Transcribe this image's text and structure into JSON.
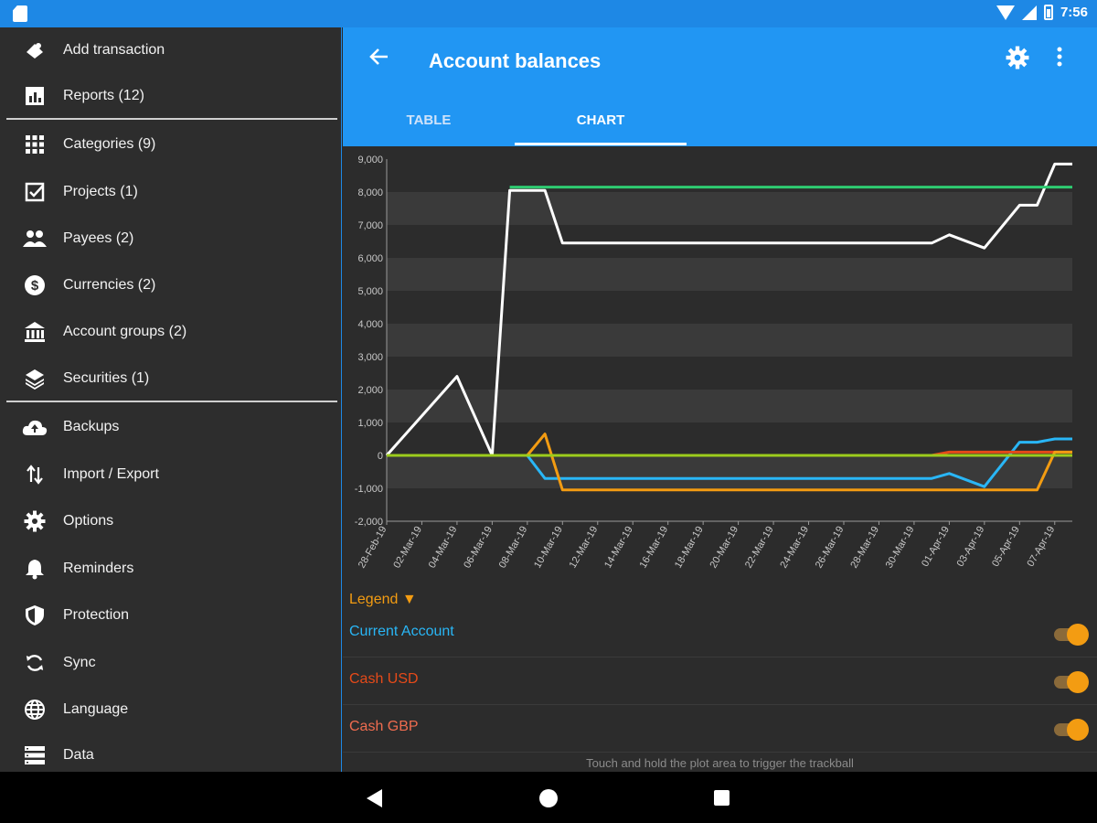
{
  "status": {
    "time": "7:56"
  },
  "drawer": {
    "items": [
      {
        "label": "Add transaction",
        "icon": "add-transaction-icon"
      },
      {
        "label": "Reports (12)",
        "icon": "reports-icon"
      },
      {
        "label": "Categories (9)",
        "icon": "grid-icon"
      },
      {
        "label": "Projects (1)",
        "icon": "checkbox-icon"
      },
      {
        "label": "Payees (2)",
        "icon": "people-icon"
      },
      {
        "label": "Currencies (2)",
        "icon": "dollar-icon"
      },
      {
        "label": "Account groups (2)",
        "icon": "bank-icon"
      },
      {
        "label": "Securities (1)",
        "icon": "layers-icon"
      },
      {
        "label": "Backups",
        "icon": "cloud-upload-icon"
      },
      {
        "label": "Import / Export",
        "icon": "import-export-icon"
      },
      {
        "label": "Options",
        "icon": "gear-icon"
      },
      {
        "label": "Reminders",
        "icon": "bell-icon"
      },
      {
        "label": "Protection",
        "icon": "shield-icon"
      },
      {
        "label": "Sync",
        "icon": "sync-icon"
      },
      {
        "label": "Language",
        "icon": "globe-icon"
      },
      {
        "label": "Data",
        "icon": "data-icon"
      }
    ]
  },
  "appbar": {
    "title": "Account balances",
    "tabs": [
      "TABLE",
      "CHART"
    ],
    "active_tab": "CHART"
  },
  "legend": {
    "toggle_label": "Legend ▼",
    "items": [
      {
        "name": "Current Account",
        "color": "#29b6f6",
        "enabled": true
      },
      {
        "name": "Cash USD",
        "color": "#e64a19",
        "enabled": true
      },
      {
        "name": "Cash GBP",
        "color": "#ef6c4f",
        "enabled": true
      }
    ]
  },
  "hint": "Touch and hold the plot area to trigger the trackball",
  "chart_data": {
    "type": "line",
    "ylim": [
      -2000,
      9000
    ],
    "yticks": [
      9000,
      8000,
      7000,
      6000,
      5000,
      4000,
      3000,
      2000,
      1000,
      0,
      -1000,
      -2000
    ],
    "ytick_labels": [
      "9,000",
      "8,000",
      "7,000",
      "6,000",
      "5,000",
      "4,000",
      "3,000",
      "2,000",
      "1,000",
      "0",
      "-1,000",
      "-2,000"
    ],
    "xtick_labels": [
      "28-Feb-19",
      "02-Mar-19",
      "04-Mar-19",
      "06-Mar-19",
      "08-Mar-19",
      "10-Mar-19",
      "12-Mar-19",
      "14-Mar-19",
      "16-Mar-19",
      "18-Mar-19",
      "20-Mar-19",
      "22-Mar-19",
      "24-Mar-19",
      "26-Mar-19",
      "28-Mar-19",
      "30-Mar-19",
      "01-Apr-19",
      "03-Apr-19",
      "05-Apr-19",
      "07-Apr-19"
    ],
    "x_range_days": [
      0,
      38
    ],
    "series": [
      {
        "color": "#ffffff",
        "points": [
          [
            0,
            0
          ],
          [
            4,
            2400
          ],
          [
            6,
            0
          ],
          [
            7,
            8050
          ],
          [
            9,
            8050
          ],
          [
            10,
            6450
          ],
          [
            31,
            6450
          ],
          [
            32,
            6700
          ],
          [
            34,
            6300
          ],
          [
            36,
            7600
          ],
          [
            37,
            7600
          ],
          [
            38,
            8850
          ],
          [
            39,
            8850
          ]
        ]
      },
      {
        "color": "#2ecc71",
        "points": [
          [
            7,
            8150
          ],
          [
            39,
            8150
          ]
        ]
      },
      {
        "color": "#29b6f6",
        "points": [
          [
            0,
            0
          ],
          [
            8,
            0
          ],
          [
            9,
            -700
          ],
          [
            31,
            -700
          ],
          [
            32,
            -550
          ],
          [
            34,
            -950
          ],
          [
            36,
            400
          ],
          [
            37,
            400
          ],
          [
            38,
            500
          ],
          [
            39,
            500
          ]
        ]
      },
      {
        "name": "Cash USD",
        "color": "#e64a19",
        "points": [
          [
            31,
            0
          ],
          [
            32,
            100
          ],
          [
            39,
            100
          ]
        ]
      },
      {
        "color": "#f39c12",
        "points": [
          [
            0,
            0
          ],
          [
            8,
            0
          ],
          [
            9,
            650
          ],
          [
            10,
            -1050
          ],
          [
            37,
            -1050
          ],
          [
            38,
            100
          ],
          [
            39,
            100
          ]
        ]
      },
      {
        "color": "#9ccc1c",
        "points": [
          [
            0,
            0
          ],
          [
            39,
            0
          ]
        ]
      }
    ]
  }
}
